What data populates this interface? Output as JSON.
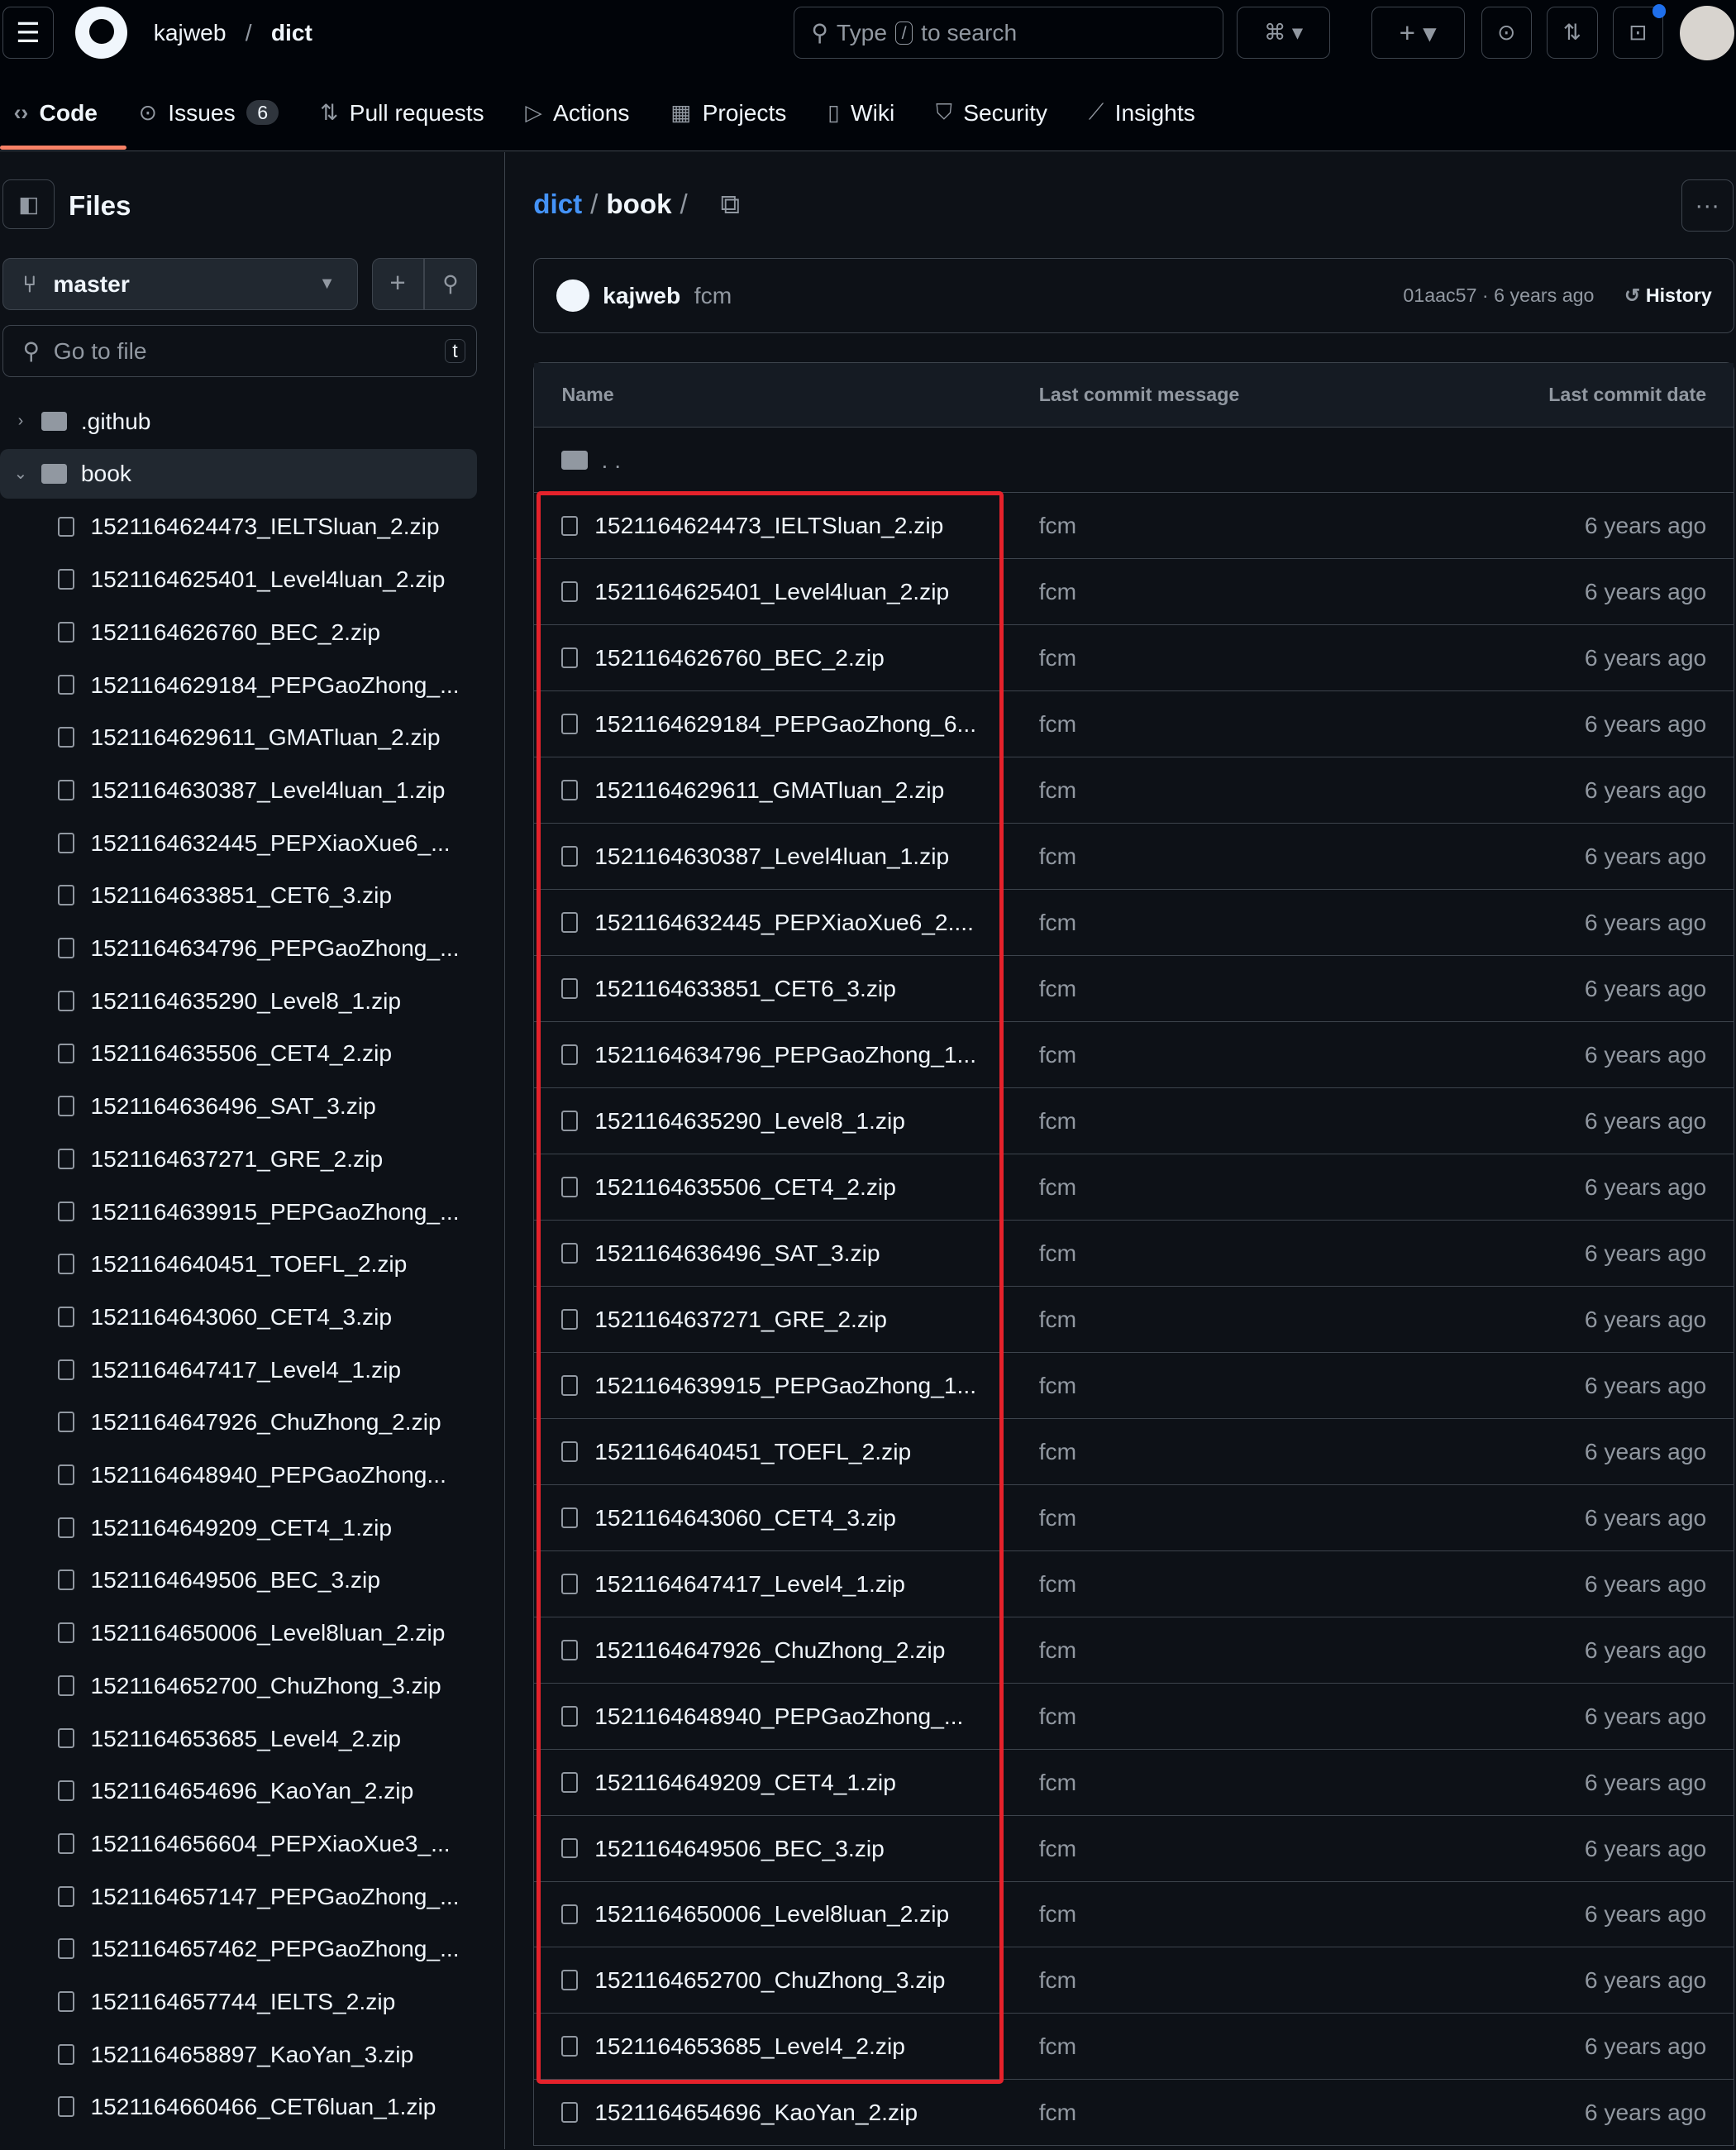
{
  "header": {
    "owner": "kajweb",
    "repo": "dict",
    "search_placeholder_pre": "Type",
    "search_key": "/",
    "search_placeholder_post": "to search"
  },
  "tabs": [
    {
      "label": "Code",
      "icon": "code-icon"
    },
    {
      "label": "Issues",
      "icon": "issue-icon",
      "count": "6"
    },
    {
      "label": "Pull requests",
      "icon": "pull-request-icon"
    },
    {
      "label": "Actions",
      "icon": "play-icon"
    },
    {
      "label": "Projects",
      "icon": "table-icon"
    },
    {
      "label": "Wiki",
      "icon": "book-icon"
    },
    {
      "label": "Security",
      "icon": "shield-icon"
    },
    {
      "label": "Insights",
      "icon": "graph-icon"
    }
  ],
  "sidebar": {
    "title": "Files",
    "branch": "master",
    "goto_placeholder": "Go to file",
    "goto_key": "t",
    "folders": [
      ".github",
      "book"
    ],
    "files": [
      "1521164624473_IELTSluan_2.zip",
      "1521164625401_Level4luan_2.zip",
      "1521164626760_BEC_2.zip",
      "1521164629184_PEPGaoZhong_...",
      "1521164629611_GMATluan_2.zip",
      "1521164630387_Level4luan_1.zip",
      "1521164632445_PEPXiaoXue6_...",
      "1521164633851_CET6_3.zip",
      "1521164634796_PEPGaoZhong_...",
      "1521164635290_Level8_1.zip",
      "1521164635506_CET4_2.zip",
      "1521164636496_SAT_3.zip",
      "1521164637271_GRE_2.zip",
      "1521164639915_PEPGaoZhong_...",
      "1521164640451_TOEFL_2.zip",
      "1521164643060_CET4_3.zip",
      "1521164647417_Level4_1.zip",
      "1521164647926_ChuZhong_2.zip",
      "1521164648940_PEPGaoZhong...",
      "1521164649209_CET4_1.zip",
      "1521164649506_BEC_3.zip",
      "1521164650006_Level8luan_2.zip",
      "1521164652700_ChuZhong_3.zip",
      "1521164653685_Level4_2.zip",
      "1521164654696_KaoYan_2.zip",
      "1521164656604_PEPXiaoXue3_...",
      "1521164657147_PEPGaoZhong_...",
      "1521164657462_PEPGaoZhong_...",
      "1521164657744_IELTS_2.zip",
      "1521164658897_KaoYan_3.zip",
      "1521164660466_CET6luan_1.zip"
    ]
  },
  "breadcrumb": {
    "root": "dict",
    "sep": "/",
    "current": "book"
  },
  "commit": {
    "author": "kajweb",
    "message": "fcm",
    "hash_time": "01aac57 · 6 years ago",
    "history": "History"
  },
  "table": {
    "headers": [
      "Name",
      "Last commit message",
      "Last commit date"
    ],
    "parent": ". .",
    "rows": [
      [
        "1521164624473_IELTSluan_2.zip",
        "fcm",
        "6 years ago"
      ],
      [
        "1521164625401_Level4luan_2.zip",
        "fcm",
        "6 years ago"
      ],
      [
        "1521164626760_BEC_2.zip",
        "fcm",
        "6 years ago"
      ],
      [
        "1521164629184_PEPGaoZhong_6...",
        "fcm",
        "6 years ago"
      ],
      [
        "1521164629611_GMATluan_2.zip",
        "fcm",
        "6 years ago"
      ],
      [
        "1521164630387_Level4luan_1.zip",
        "fcm",
        "6 years ago"
      ],
      [
        "1521164632445_PEPXiaoXue6_2....",
        "fcm",
        "6 years ago"
      ],
      [
        "1521164633851_CET6_3.zip",
        "fcm",
        "6 years ago"
      ],
      [
        "1521164634796_PEPGaoZhong_1...",
        "fcm",
        "6 years ago"
      ],
      [
        "1521164635290_Level8_1.zip",
        "fcm",
        "6 years ago"
      ],
      [
        "1521164635506_CET4_2.zip",
        "fcm",
        "6 years ago"
      ],
      [
        "1521164636496_SAT_3.zip",
        "fcm",
        "6 years ago"
      ],
      [
        "1521164637271_GRE_2.zip",
        "fcm",
        "6 years ago"
      ],
      [
        "1521164639915_PEPGaoZhong_1...",
        "fcm",
        "6 years ago"
      ],
      [
        "1521164640451_TOEFL_2.zip",
        "fcm",
        "6 years ago"
      ],
      [
        "1521164643060_CET4_3.zip",
        "fcm",
        "6 years ago"
      ],
      [
        "1521164647417_Level4_1.zip",
        "fcm",
        "6 years ago"
      ],
      [
        "1521164647926_ChuZhong_2.zip",
        "fcm",
        "6 years ago"
      ],
      [
        "1521164648940_PEPGaoZhong_...",
        "fcm",
        "6 years ago"
      ],
      [
        "1521164649209_CET4_1.zip",
        "fcm",
        "6 years ago"
      ],
      [
        "1521164649506_BEC_3.zip",
        "fcm",
        "6 years ago"
      ],
      [
        "1521164650006_Level8luan_2.zip",
        "fcm",
        "6 years ago"
      ],
      [
        "1521164652700_ChuZhong_3.zip",
        "fcm",
        "6 years ago"
      ],
      [
        "1521164653685_Level4_2.zip",
        "fcm",
        "6 years ago"
      ],
      [
        "1521164654696_KaoYan_2.zip",
        "fcm",
        "6 years ago"
      ]
    ]
  },
  "colors": {
    "accent": "#4493f8",
    "highlight": "#e5222b",
    "tab_underline": "#f78166"
  }
}
